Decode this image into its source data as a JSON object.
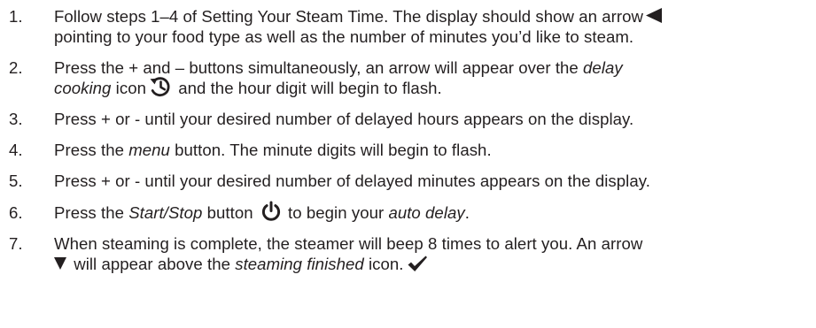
{
  "steps": [
    {
      "number": "1.",
      "line1": "Follow steps 1–4 of Setting Your Steam Time. The display should show an arrow",
      "line2": "pointing to your food type as well as the number of minutes you’d like to steam."
    },
    {
      "number": "2.",
      "line1": "Press the + and – buttons simultaneously, an arrow will appear over the ",
      "line1_italic": "delay",
      "line2_italic": "cooking",
      "line2_a": " icon",
      "line2_b": " and the hour digit will begin to flash."
    },
    {
      "number": "3.",
      "line1": "Press + or - until your desired number of delayed hours appears on the display."
    },
    {
      "number": "4.",
      "line1_a": "Press the ",
      "line1_italic": "menu",
      "line1_b": " button. The minute digits will begin to flash."
    },
    {
      "number": "5.",
      "line1": "Press + or - until your desired number of delayed minutes appears on the display."
    },
    {
      "number": "6.",
      "line1_a": "Press the ",
      "line1_italic": "Start/Stop",
      "line1_b": " button ",
      "line1_c": " to begin your ",
      "line1_italic2": "auto delay",
      "line1_d": "."
    },
    {
      "number": "7.",
      "line1": "When steaming is complete, the steamer will beep 8 times to alert you. An arrow",
      "line2_a": " will appear above the ",
      "line2_italic": "steaming finished",
      "line2_b": " icon."
    }
  ],
  "colors": {
    "text": "#231f20"
  },
  "icons": [
    "left-pointing-triangle-icon",
    "delay-cooking-clock-icon",
    "power-icon",
    "down-pointing-triangle-icon",
    "checkmark-icon"
  ]
}
